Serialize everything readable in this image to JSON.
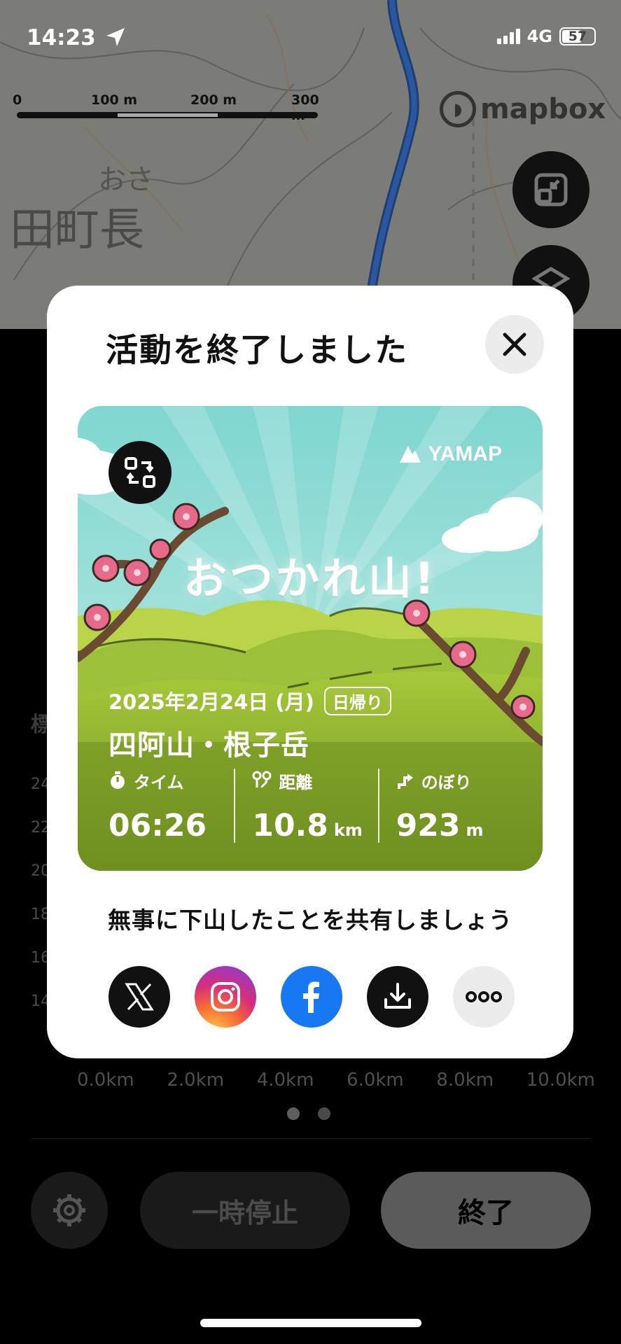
{
  "status_bar": {
    "time": "14:23",
    "network": "4G",
    "battery": "57"
  },
  "map": {
    "scale_labels": [
      "0",
      "100 m",
      "200 m",
      "300 m"
    ],
    "attribution": "mapbox",
    "place_label_small": "おさ",
    "place_label_large": "田町長"
  },
  "sheet": {
    "x_axis": [
      "0.0km",
      "2.0km",
      "4.0km",
      "6.0km",
      "8.0km",
      "10.0km"
    ],
    "y_axis": [
      "24",
      "22",
      "20",
      "18",
      "16",
      "14"
    ],
    "side_label": "標",
    "pause_label": "一時停止",
    "end_label": "終了"
  },
  "modal": {
    "title": "活動を終了しました",
    "card": {
      "brand": "YAMAP",
      "message": "おつかれ山!",
      "date": "2025年2月24日 (月)",
      "trip_type": "日帰り",
      "mountain": "四阿山・根子岳",
      "stats": [
        {
          "label": "タイム",
          "value": "06:26",
          "unit": "",
          "icon": "stopwatch-icon"
        },
        {
          "label": "距離",
          "value": "10.8",
          "unit": "km",
          "icon": "route-icon"
        },
        {
          "label": "のぼり",
          "value": "923",
          "unit": "m",
          "icon": "ascent-arrow-icon"
        }
      ]
    },
    "share_prompt": "無事に下山したことを共有しましょう",
    "share_targets": [
      "x-icon",
      "instagram-icon",
      "facebook-icon",
      "download-icon",
      "more-icon"
    ]
  },
  "colors": {
    "sky": "#8fdcd5",
    "hill": "#9bc23a",
    "facebook": "#1877f2",
    "blossom": "#e86a8a",
    "route": "#1f4f9a"
  }
}
